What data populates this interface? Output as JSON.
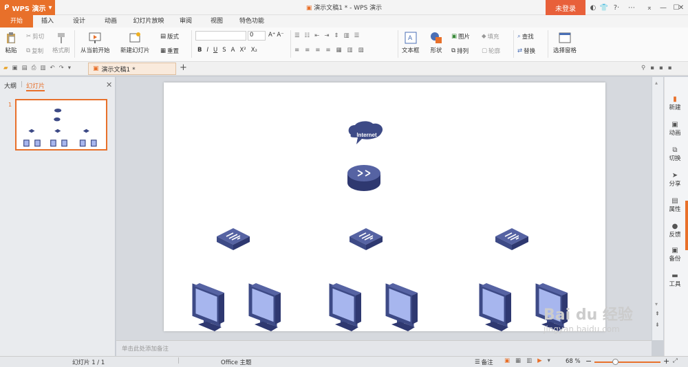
{
  "app": {
    "brand": "WPS 演示",
    "doc_title": "演示文稿1 * - WPS 演示",
    "login": "未登录"
  },
  "tabs": [
    "开始",
    "插入",
    "设计",
    "动画",
    "幻灯片放映",
    "审阅",
    "视图",
    "特色功能"
  ],
  "ribbon": {
    "paste": "粘贴",
    "cut": "剪切",
    "copy": "复制",
    "format_painter": "格式刷",
    "from_current": "从当前开始",
    "new_slide": "新建幻灯片",
    "layout": "版式",
    "reset": "重置",
    "font_size": "0",
    "textbox": "文本框",
    "shape": "形状",
    "picture": "图片",
    "fill": "填充",
    "arrange": "排列",
    "outline": "轮廓",
    "find": "查找",
    "replace": "替换",
    "select_pane": "选择窗格"
  },
  "doc_tab": "演示文稿1 *",
  "left_panel": {
    "outline_tab": "大纲",
    "slides_tab": "幻灯片",
    "slide_number": "1"
  },
  "slide": {
    "internet_label": "Internet"
  },
  "notes_placeholder": "单击此处添加备注",
  "sidebar": [
    "新建",
    "动画",
    "切换",
    "分享",
    "属性",
    "反馈",
    "备份",
    "工具"
  ],
  "status": {
    "slide_info": "幻灯片 1 / 1",
    "theme": "Office 主题",
    "notes": "备注",
    "zoom": "68 %"
  },
  "colors": {
    "accent": "#e8702a",
    "device": "#3d4a86",
    "screen": "#a7b6ee"
  }
}
